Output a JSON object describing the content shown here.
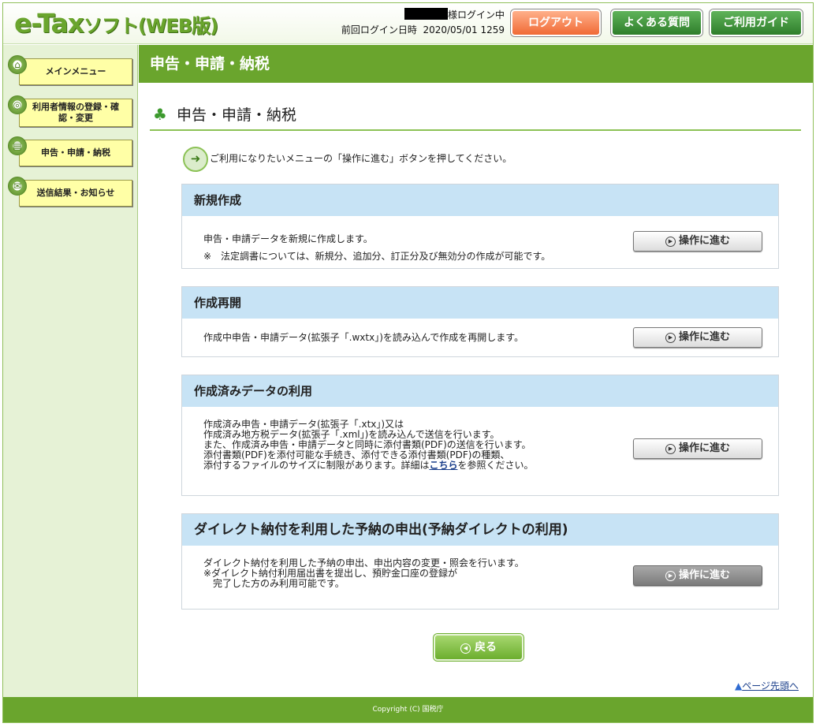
{
  "header": {
    "logo_main": "e-Tax",
    "logo_sub": "ソフト(WEB版)",
    "user_suffix": "様ログイン中",
    "last_login_label": "前回ログイン日時",
    "last_login_value": "2020/05/01 1259",
    "logout_label": "ログアウト",
    "faq_label": "よくある質問",
    "guide_label": "ご利用ガイド"
  },
  "sidebar": {
    "items": [
      {
        "label": "メインメニュー",
        "icon": "home-icon"
      },
      {
        "label": "利用者情報の登録・確認・変更",
        "icon": "user-info-icon"
      },
      {
        "label": "申告・申請・納税",
        "icon": "submission-icon"
      },
      {
        "label": "送信結果・お知らせ",
        "icon": "mailbox-icon"
      }
    ]
  },
  "main": {
    "title": "申告・申請・納税",
    "subtitle": "申告・申請・納税",
    "hint": "ご利用になりたいメニューの「操作に進む」ボタンを押してください。",
    "panels": [
      {
        "title": "新規作成",
        "lines": [
          "申告・申請データを新規に作成します。",
          "※　法定調書については、新規分、追加分、訂正分及び無効分の作成が可能です。"
        ],
        "button": "操作に進む"
      },
      {
        "title": "作成再開",
        "lines": [
          "作成中申告・申請データ(拡張子「.wxtx」)を読み込んで作成を再開します。"
        ],
        "button": "操作に進む"
      },
      {
        "title": "作成済みデータの利用",
        "lines": [
          "作成済み申告・申請データ(拡張子「.xtx」)又は",
          "作成済み地方税データ(拡張子「.xml」)を読み込んで送信を行います。",
          "また、作成済み申告・申請データと同時に添付書類(PDF)の送信を行います。",
          "添付書類(PDF)を添付可能な手続き、添付できる添付書類(PDF)の種類、",
          "添付するファイルのサイズに制限があります。詳細は"
        ],
        "link": "こちら",
        "link_after": "を参照ください。",
        "button": "操作に進む"
      },
      {
        "title": "ダイレクト納付を利用した予納の申出(予納ダイレクトの利用)",
        "lines": [
          "ダイレクト納付を利用した予納の申出、申出内容の変更・照会を行います。",
          "※ダイレクト納付利用届出書を提出し、預貯金口座の登録が",
          "　完了した方のみ利用可能です。"
        ],
        "button": "操作に進む"
      }
    ],
    "back_label": "戻る",
    "pagetop_label": "ページ先頭へ"
  },
  "footer": {
    "copyright": "Copyright (C) 国税庁"
  },
  "colors": {
    "brand_green": "#6aa52d",
    "panel_header": "#c7e3f5",
    "sidebar_bg": "#e6f2d6",
    "logout_orange": "#f06a35"
  }
}
